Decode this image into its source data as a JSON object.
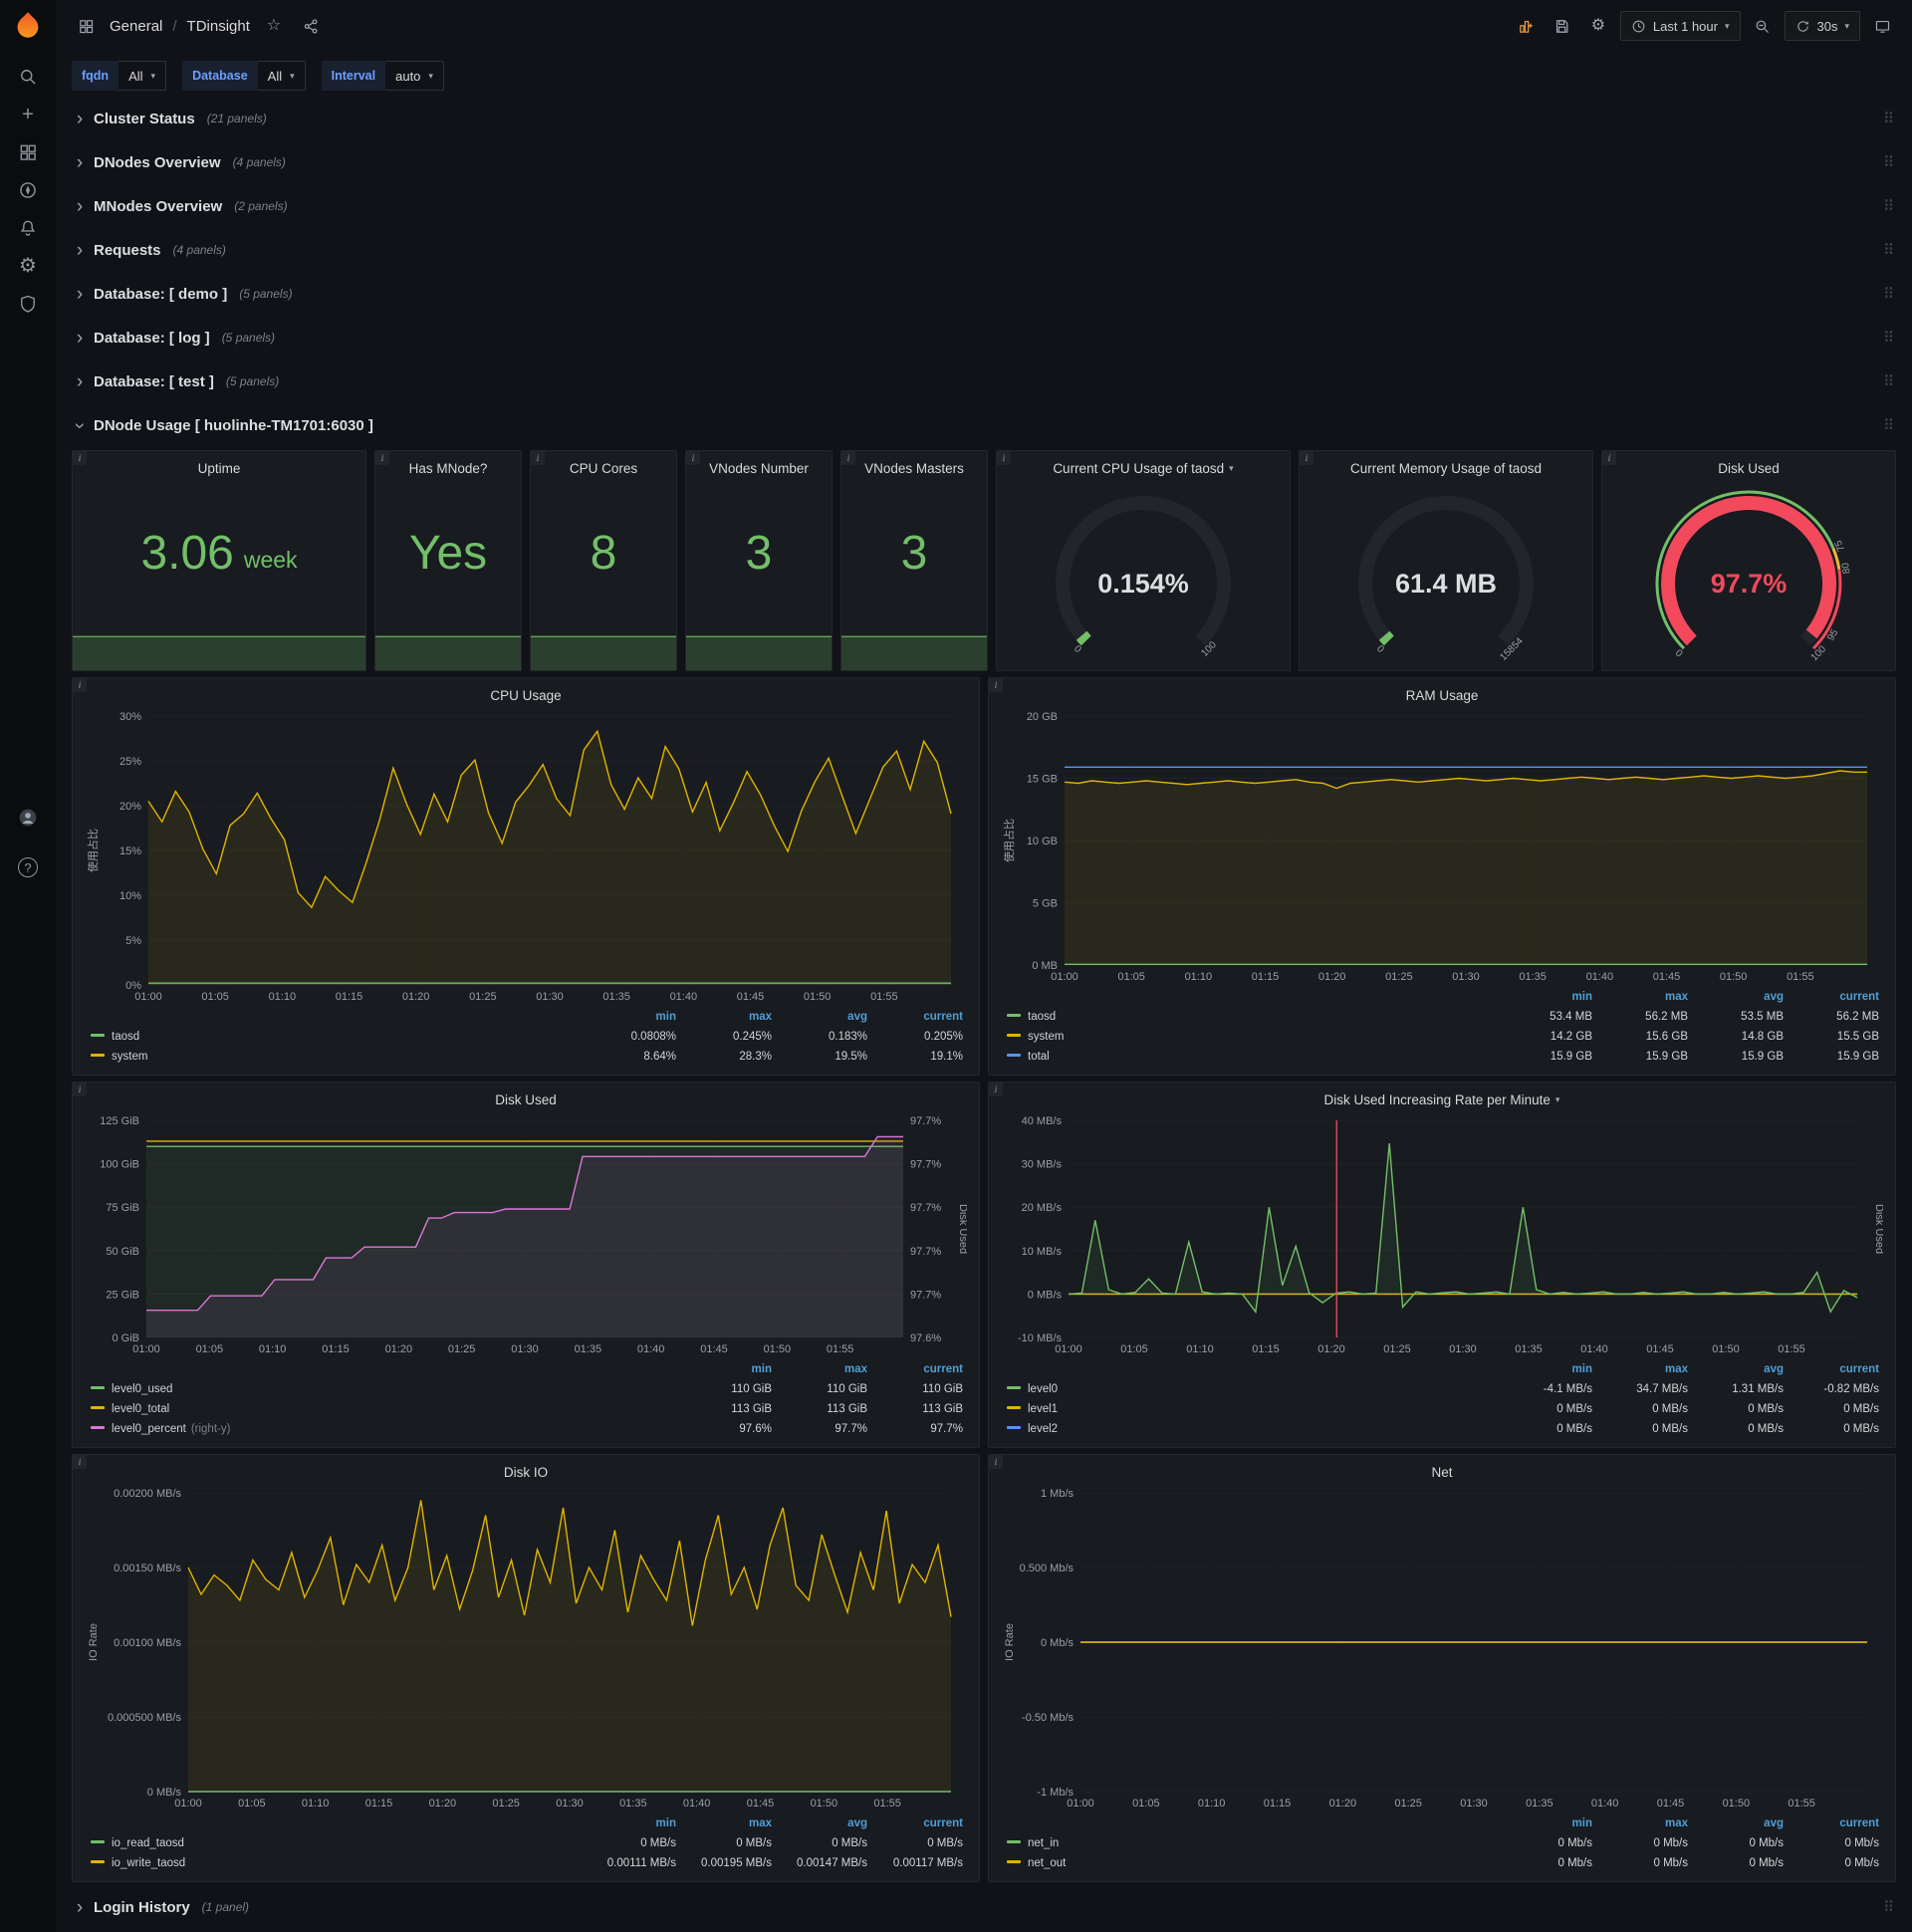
{
  "topnav": {
    "section": "General",
    "separator": "/",
    "page": "TDinsight",
    "time_range": "Last 1 hour",
    "refresh": "30s"
  },
  "glyphs": {
    "chevron": "›",
    "star": "☆",
    "gear": "⚙",
    "caret": "▾",
    "drag": "⠿",
    "plus": "+",
    "info": "i",
    "question": "?"
  },
  "colors": {
    "brand_orange": "#f05a28",
    "green": "#73bf69",
    "yellow": "#e0b400",
    "blue": "#5794f2",
    "red": "#f2495c",
    "pink": "#d877d9"
  },
  "variables": [
    {
      "label": "fqdn",
      "value": "All"
    },
    {
      "label": "Database",
      "value": "All"
    },
    {
      "label": "Interval",
      "value": "auto"
    }
  ],
  "rows": [
    {
      "title": "Cluster Status",
      "count": "(21 panels)"
    },
    {
      "title": "DNodes Overview",
      "count": "(4 panels)"
    },
    {
      "title": "MNodes Overview",
      "count": "(2 panels)"
    },
    {
      "title": "Requests",
      "count": "(4 panels)"
    },
    {
      "title": "Database: [ demo ]",
      "count": "(5 panels)"
    },
    {
      "title": "Database: [ log ]",
      "count": "(5 panels)"
    },
    {
      "title": "Database: [ test ]",
      "count": "(5 panels)"
    }
  ],
  "dnode_row": {
    "title": "DNode Usage [ huolinhe-TM1701:6030 ]"
  },
  "login_row": {
    "title": "Login History",
    "count": "(1 panel)"
  },
  "stats": {
    "uptime": {
      "title": "Uptime",
      "value": "3.06",
      "unit": "week"
    },
    "has_mnode": {
      "title": "Has MNode?",
      "value": "Yes",
      "unit": ""
    },
    "cpu_cores": {
      "title": "CPU Cores",
      "value": "8",
      "unit": ""
    },
    "vnodes_number": {
      "title": "VNodes Number",
      "value": "3",
      "unit": ""
    },
    "vnodes_masters": {
      "title": "VNodes Masters",
      "value": "3",
      "unit": ""
    },
    "cpu_gauge": {
      "title": "Current CPU Usage of taosd",
      "value": "0.154%",
      "frac": 0.00154,
      "color": "#73bf69",
      "value_color": "#dcdee1",
      "ticks": [
        {
          "frac": 0,
          "label": "0"
        },
        {
          "frac": 1,
          "label": "100"
        }
      ]
    },
    "mem_gauge": {
      "title": "Current Memory Usage of taosd",
      "value": "61.4 MB",
      "frac": 0.004,
      "color": "#73bf69",
      "value_color": "#dcdee1",
      "ticks": [
        {
          "frac": 0,
          "label": "0"
        },
        {
          "frac": 1,
          "label": "15854"
        }
      ]
    },
    "disk_gauge": {
      "title": "Disk Used",
      "value": "97.7%",
      "frac": 0.977,
      "color": "#f2495c",
      "value_color": "#f2495c",
      "ticks": [
        {
          "frac": 0,
          "label": "0"
        },
        {
          "frac": 0.75,
          "label": "75"
        },
        {
          "frac": 0.8,
          "label": "80"
        },
        {
          "frac": 0.95,
          "label": "95"
        },
        {
          "frac": 1,
          "label": "100"
        }
      ],
      "thresholds": [
        {
          "from": 0,
          "to": 0.75,
          "color": "#73bf69"
        },
        {
          "from": 0.75,
          "to": 0.8,
          "color": "#eab839"
        },
        {
          "from": 0.8,
          "to": 1,
          "color": "#f2495c"
        }
      ]
    }
  },
  "charts": {
    "spark": {
      "sparkline": true,
      "y_min": 0,
      "y_max": 1.3,
      "x_count": 40,
      "series": [
        {
          "name": "history",
          "color": "#73bf69",
          "fill": true,
          "values": {
            "flat": 1
          }
        }
      ]
    },
    "cpu": {
      "type": "line",
      "title": "CPU Usage",
      "ylabel": "使用占比",
      "ml": 64,
      "mr": 16,
      "y_min": 0,
      "y_max": 30,
      "y_ticks": [
        "0%",
        "5%",
        "10%",
        "15%",
        "20%",
        "25%",
        "30%"
      ],
      "x_ticks": [
        "01:00",
        "01:05",
        "01:10",
        "01:15",
        "01:20",
        "01:25",
        "01:30",
        "01:35",
        "01:40",
        "01:45",
        "01:50",
        "01:55"
      ],
      "x_count": 60,
      "series": [
        {
          "name": "system",
          "color": "#e0b400",
          "fill": true,
          "values": [
            20.5,
            18.2,
            21.6,
            19.3,
            15.2,
            12.4,
            17.8,
            19.1,
            21.4,
            18.6,
            16.2,
            10.3,
            8.64,
            12.1,
            10.5,
            9.2,
            13.6,
            18.4,
            24.2,
            20.1,
            16.8,
            21.3,
            18.2,
            23.4,
            25.1,
            19.2,
            15.8,
            20.4,
            22.3,
            24.6,
            20.8,
            18.9,
            26.2,
            28.3,
            22.4,
            19.6,
            23.1,
            20.8,
            26.6,
            24.1,
            19.3,
            22.6,
            17.2,
            20.3,
            23.8,
            21.2,
            17.8,
            14.9,
            19.4,
            22.7,
            25.3,
            21.1,
            16.9,
            20.6,
            24.3,
            26.1,
            21.8,
            27.2,
            24.8,
            19.1
          ]
        },
        {
          "name": "taosd",
          "color": "#73bf69",
          "fill": true,
          "values": {
            "flat": 0.2
          }
        }
      ],
      "legend_cols": [
        "min",
        "max",
        "avg",
        "current"
      ],
      "legend": [
        {
          "name": "taosd",
          "color": "#73bf69",
          "values": [
            "0.0808%",
            "0.245%",
            "0.183%",
            "0.205%"
          ]
        },
        {
          "name": "system",
          "color": "#e0b400",
          "values": [
            "8.64%",
            "28.3%",
            "19.5%",
            "19.1%"
          ]
        }
      ]
    },
    "ram": {
      "type": "line",
      "title": "RAM Usage",
      "ylabel": "使用占比",
      "ml": 64,
      "mr": 16,
      "y_min": 0,
      "y_max": 20,
      "y_ticks": [
        "0 MB",
        "5 GB",
        "10 GB",
        "15 GB",
        "20 GB"
      ],
      "x_ticks": [
        "01:00",
        "01:05",
        "01:10",
        "01:15",
        "01:20",
        "01:25",
        "01:30",
        "01:35",
        "01:40",
        "01:45",
        "01:50",
        "01:55"
      ],
      "x_count": 60,
      "series": [
        {
          "name": "system",
          "color": "#e0b400",
          "fill": true,
          "values": [
            14.7,
            14.6,
            14.8,
            14.7,
            14.6,
            14.7,
            14.8,
            14.7,
            14.6,
            14.5,
            14.6,
            14.7,
            14.8,
            14.7,
            14.6,
            14.7,
            14.8,
            14.9,
            14.7,
            14.6,
            14.2,
            14.6,
            14.7,
            14.8,
            14.9,
            14.8,
            14.7,
            14.8,
            14.9,
            15.0,
            14.9,
            14.8,
            14.9,
            15.0,
            14.9,
            14.8,
            14.9,
            15.0,
            15.1,
            15.0,
            14.9,
            15.0,
            15.1,
            15.0,
            14.9,
            15.0,
            15.1,
            15.2,
            15.1,
            15.0,
            15.1,
            15.2,
            15.1,
            15.0,
            15.1,
            15.2,
            15.4,
            15.6,
            15.5,
            15.5
          ]
        },
        {
          "name": "total",
          "color": "#5794f2",
          "fill": false,
          "values": {
            "flat": 15.9
          }
        },
        {
          "name": "taosd",
          "color": "#73bf69",
          "fill": true,
          "values": {
            "flat": 0.054
          }
        }
      ],
      "legend_cols": [
        "min",
        "max",
        "avg",
        "current"
      ],
      "legend": [
        {
          "name": "taosd",
          "color": "#73bf69",
          "values": [
            "53.4 MB",
            "56.2 MB",
            "53.5 MB",
            "56.2 MB"
          ]
        },
        {
          "name": "system",
          "color": "#e0b400",
          "values": [
            "14.2 GB",
            "15.6 GB",
            "14.8 GB",
            "15.5 GB"
          ]
        },
        {
          "name": "total",
          "color": "#5794f2",
          "values": [
            "15.9 GB",
            "15.9 GB",
            "15.9 GB",
            "15.9 GB"
          ]
        }
      ]
    },
    "disk": {
      "type": "line",
      "title": "Disk Used",
      "ml": 62,
      "mr": 64,
      "y_min": 0,
      "y_max": 125,
      "y_ticks": [
        "0 GiB",
        "25 GiB",
        "50 GiB",
        "75 GiB",
        "100 GiB",
        "125 GiB"
      ],
      "y2_min": 97.59,
      "y2_max": 97.71,
      "y2_ticks": [
        "97.6%",
        "97.7%",
        "97.7%",
        "97.7%",
        "97.7%",
        "97.7%"
      ],
      "y2label": "Disk Used",
      "x_ticks": [
        "01:00",
        "01:05",
        "01:10",
        "01:15",
        "01:20",
        "01:25",
        "01:30",
        "01:35",
        "01:40",
        "01:45",
        "01:50",
        "01:55"
      ],
      "x_count": 60,
      "series": [
        {
          "name": "level0_used",
          "color": "#73bf69",
          "fill": true,
          "values": {
            "flat": 110
          }
        },
        {
          "name": "level0_total",
          "color": "#e0b400",
          "fill": false,
          "values": {
            "flat": 113
          }
        },
        {
          "name": "level0_percent",
          "color": "#d877d9",
          "fill": true,
          "axis": "right",
          "values": [
            97.605,
            97.605,
            97.605,
            97.605,
            97.605,
            97.613,
            97.613,
            97.613,
            97.613,
            97.613,
            97.622,
            97.622,
            97.622,
            97.622,
            97.634,
            97.634,
            97.634,
            97.64,
            97.64,
            97.64,
            97.64,
            97.64,
            97.656,
            97.656,
            97.659,
            97.659,
            97.659,
            97.659,
            97.661,
            97.661,
            97.661,
            97.661,
            97.661,
            97.661,
            97.69,
            97.69,
            97.69,
            97.69,
            97.69,
            97.69,
            97.69,
            97.69,
            97.69,
            97.69,
            97.69,
            97.69,
            97.69,
            97.69,
            97.69,
            97.69,
            97.69,
            97.69,
            97.69,
            97.69,
            97.69,
            97.69,
            97.69,
            97.701,
            97.701,
            97.701
          ]
        }
      ],
      "legend_cols": [
        "min",
        "max",
        "current"
      ],
      "legend": [
        {
          "name": "level0_used",
          "color": "#73bf69",
          "values": [
            "110 GiB",
            "110 GiB",
            "110 GiB"
          ]
        },
        {
          "name": "level0_total",
          "color": "#e0b400",
          "values": [
            "113 GiB",
            "113 GiB",
            "113 GiB"
          ]
        },
        {
          "name": "level0_percent",
          "suffix": "(right-y)",
          "color": "#d877d9",
          "values": [
            "97.6%",
            "97.7%",
            "97.7%"
          ]
        }
      ]
    },
    "diskrate": {
      "type": "line",
      "title": "Disk Used Increasing Rate per Minute",
      "ml": 68,
      "mr": 26,
      "y2label": "Disk Used",
      "y_min": -10,
      "y_max": 40,
      "y_ticks": [
        "-10 MB/s",
        "0 MB/s",
        "10 MB/s",
        "20 MB/s",
        "30 MB/s",
        "40 MB/s"
      ],
      "x_ticks": [
        "01:00",
        "01:05",
        "01:10",
        "01:15",
        "01:20",
        "01:25",
        "01:30",
        "01:35",
        "01:40",
        "01:45",
        "01:50",
        "01:55"
      ],
      "x_count": 60,
      "annotation_frac": 0.34,
      "series": [
        {
          "name": "level2",
          "color": "#5794f2",
          "fill": false,
          "values": {
            "flat": 0
          }
        },
        {
          "name": "level1",
          "color": "#e0b400",
          "fill": false,
          "values": {
            "flat": 0
          }
        },
        {
          "name": "level0",
          "color": "#73bf69",
          "fill": true,
          "values": [
            0,
            0.2,
            17,
            1,
            0,
            0.4,
            3.5,
            0.2,
            0,
            12,
            0.5,
            0,
            0.2,
            0,
            -4.1,
            20,
            2,
            11,
            0.3,
            -2,
            0.2,
            0.5,
            0,
            0.2,
            34.7,
            -3,
            0.5,
            0,
            0.3,
            0.5,
            0,
            0.2,
            0.5,
            0,
            20,
            1,
            0,
            0.4,
            0,
            0.2,
            0.5,
            0,
            0,
            0.4,
            0,
            0.2,
            0.5,
            0,
            0,
            0.4,
            0,
            0.2,
            0.5,
            0,
            0,
            0.4,
            5,
            -4.1,
            0.8,
            -0.82
          ]
        }
      ],
      "legend_cols": [
        "min",
        "max",
        "avg",
        "current"
      ],
      "legend": [
        {
          "name": "level0",
          "color": "#73bf69",
          "values": [
            "-4.1 MB/s",
            "34.7 MB/s",
            "1.31 MB/s",
            "-0.82 MB/s"
          ]
        },
        {
          "name": "level1",
          "color": "#e0b400",
          "values": [
            "0 MB/s",
            "0 MB/s",
            "0 MB/s",
            "0 MB/s"
          ]
        },
        {
          "name": "level2",
          "color": "#5794f2",
          "values": [
            "0 MB/s",
            "0 MB/s",
            "0 MB/s",
            "0 MB/s"
          ]
        }
      ]
    },
    "diskio": {
      "type": "line",
      "title": "Disk IO",
      "ylabel": "IO Rate",
      "ml": 104,
      "mr": 16,
      "y_min": 0,
      "y_max": 0.002,
      "y_ticks": [
        "0 MB/s",
        "0.000500 MB/s",
        "0.00100 MB/s",
        "0.00150 MB/s",
        "0.00200 MB/s"
      ],
      "x_ticks": [
        "01:00",
        "01:05",
        "01:10",
        "01:15",
        "01:20",
        "01:25",
        "01:30",
        "01:35",
        "01:40",
        "01:45",
        "01:50",
        "01:55"
      ],
      "x_count": 60,
      "series": [
        {
          "name": "io_write_taosd",
          "color": "#e0b400",
          "fill": true,
          "values": [
            0.0015,
            0.00132,
            0.00145,
            0.00138,
            0.00128,
            0.00155,
            0.00142,
            0.00135,
            0.0016,
            0.0013,
            0.00148,
            0.0017,
            0.00125,
            0.00152,
            0.0014,
            0.00165,
            0.00128,
            0.0015,
            0.00195,
            0.00135,
            0.00158,
            0.00122,
            0.00148,
            0.00185,
            0.0013,
            0.00155,
            0.00118,
            0.00162,
            0.0014,
            0.0019,
            0.00126,
            0.0015,
            0.00135,
            0.00175,
            0.0012,
            0.00158,
            0.00142,
            0.00128,
            0.00168,
            0.00111,
            0.00155,
            0.00185,
            0.00132,
            0.0015,
            0.00122,
            0.00165,
            0.0019,
            0.00138,
            0.00128,
            0.00172,
            0.00145,
            0.0012,
            0.0016,
            0.00135,
            0.00188,
            0.00126,
            0.00152,
            0.0014,
            0.00165,
            0.00117
          ]
        },
        {
          "name": "io_read_taosd",
          "color": "#73bf69",
          "fill": false,
          "values": {
            "flat": 0
          }
        }
      ],
      "legend_cols": [
        "min",
        "max",
        "avg",
        "current"
      ],
      "legend": [
        {
          "name": "io_read_taosd",
          "color": "#73bf69",
          "values": [
            "0 MB/s",
            "0 MB/s",
            "0 MB/s",
            "0 MB/s"
          ]
        },
        {
          "name": "io_write_taosd",
          "color": "#e0b400",
          "values": [
            "0.00111 MB/s",
            "0.00195 MB/s",
            "0.00147 MB/s",
            "0.00117 MB/s"
          ]
        }
      ]
    },
    "net": {
      "type": "line",
      "title": "Net",
      "ylabel": "IO Rate",
      "ml": 80,
      "mr": 16,
      "y_min": -1,
      "y_max": 1,
      "y_ticks": [
        "-1 Mb/s",
        "-0.50 Mb/s",
        "0 Mb/s",
        "0.500 Mb/s",
        "1 Mb/s"
      ],
      "x_ticks": [
        "01:00",
        "01:05",
        "01:10",
        "01:15",
        "01:20",
        "01:25",
        "01:30",
        "01:35",
        "01:40",
        "01:45",
        "01:50",
        "01:55"
      ],
      "x_count": 60,
      "series": [
        {
          "name": "net_in",
          "color": "#73bf69",
          "fill": false,
          "values": {
            "flat": 0
          }
        },
        {
          "name": "net_out",
          "color": "#e0b400",
          "fill": false,
          "values": {
            "flat": 0
          }
        }
      ],
      "legend_cols": [
        "min",
        "max",
        "avg",
        "current"
      ],
      "legend": [
        {
          "name": "net_in",
          "color": "#73bf69",
          "values": [
            "0 Mb/s",
            "0 Mb/s",
            "0 Mb/s",
            "0 Mb/s"
          ]
        },
        {
          "name": "net_out",
          "color": "#e0b400",
          "values": [
            "0 Mb/s",
            "0 Mb/s",
            "0 Mb/s",
            "0 Mb/s"
          ]
        }
      ]
    }
  }
}
